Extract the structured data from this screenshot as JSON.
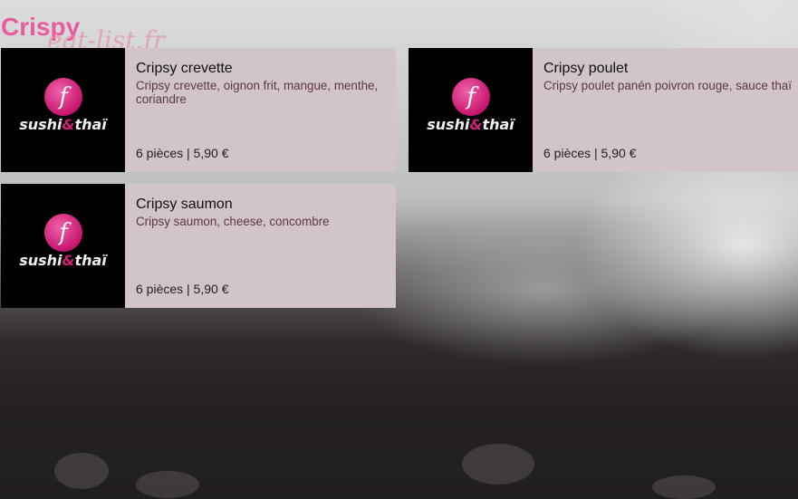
{
  "page": {
    "category_title": "Crispy",
    "watermark": "eat-list.fr"
  },
  "logo": {
    "glyph": "f",
    "text_left": "sushi",
    "text_amp": "&",
    "text_right": "thaï"
  },
  "items": [
    {
      "title": "Cripsy crevette",
      "description": "Cripsy crevette, oignon frit, mangue, menthe, coriandre",
      "price": "6 pièces | 5,90 €"
    },
    {
      "title": "Cripsy poulet",
      "description": "Cripsy poulet panén poivron rouge, sauce thaï",
      "price": "6 pièces | 5,90 €"
    },
    {
      "title": "Cripsy saumon",
      "description": "Cripsy saumon, cheese, concombre",
      "price": "6 pièces | 5,90 €"
    }
  ],
  "colors": {
    "accent": "#ea5aa0",
    "card_background": "#d2c4cb",
    "logo_background": "#000000"
  }
}
